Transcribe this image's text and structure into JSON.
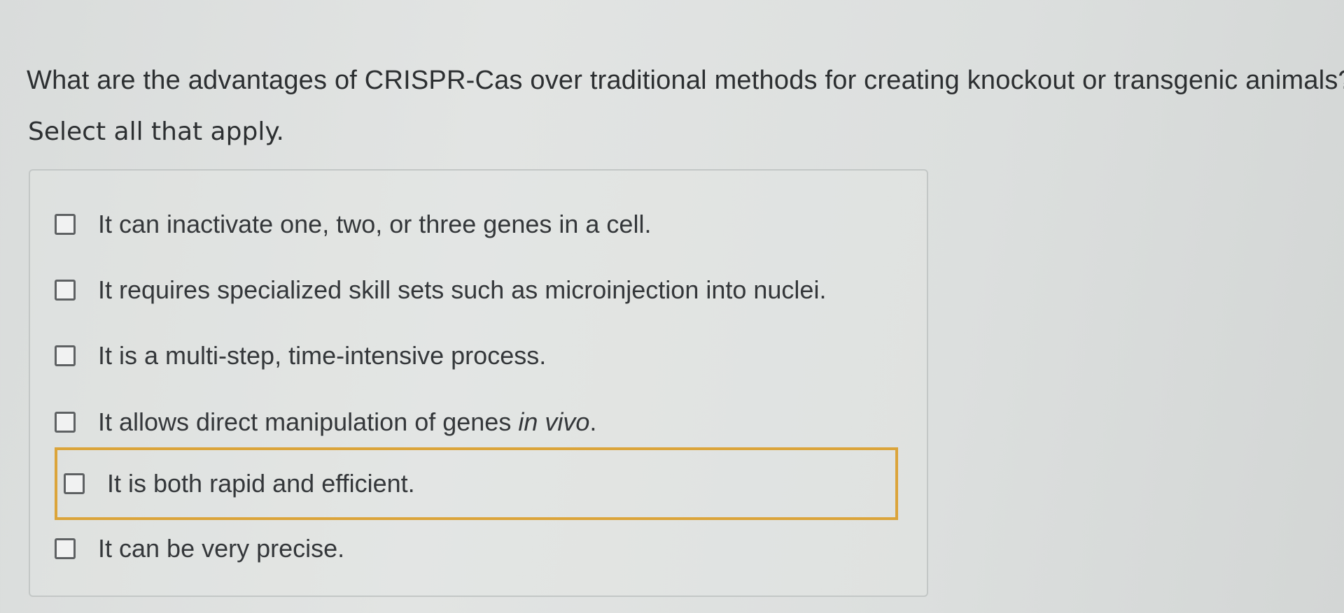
{
  "question": {
    "prompt": "What are the advantages of CRISPR-Cas over traditional methods for creating knockout or transgenic animals?",
    "instruction": "Select all that apply."
  },
  "options": [
    {
      "text": "It can inactivate one, two, or three genes in a cell.",
      "checked": false
    },
    {
      "text": "It requires specialized skill sets such as microinjection into nuclei.",
      "checked": false
    },
    {
      "text": "It is a multi-step, time-intensive process.",
      "checked": false
    },
    {
      "text_before": "It allows direct manipulation of genes ",
      "text_italic": "in vivo",
      "text_after": ".",
      "checked": false
    },
    {
      "text": "It is both rapid and efficient.",
      "checked": false,
      "focused": true
    },
    {
      "text": "It can be very precise.",
      "checked": false
    }
  ],
  "colors": {
    "focus_outline": "#dba43a",
    "checkbox_border": "#5e6163",
    "text": "#2c2f31"
  }
}
